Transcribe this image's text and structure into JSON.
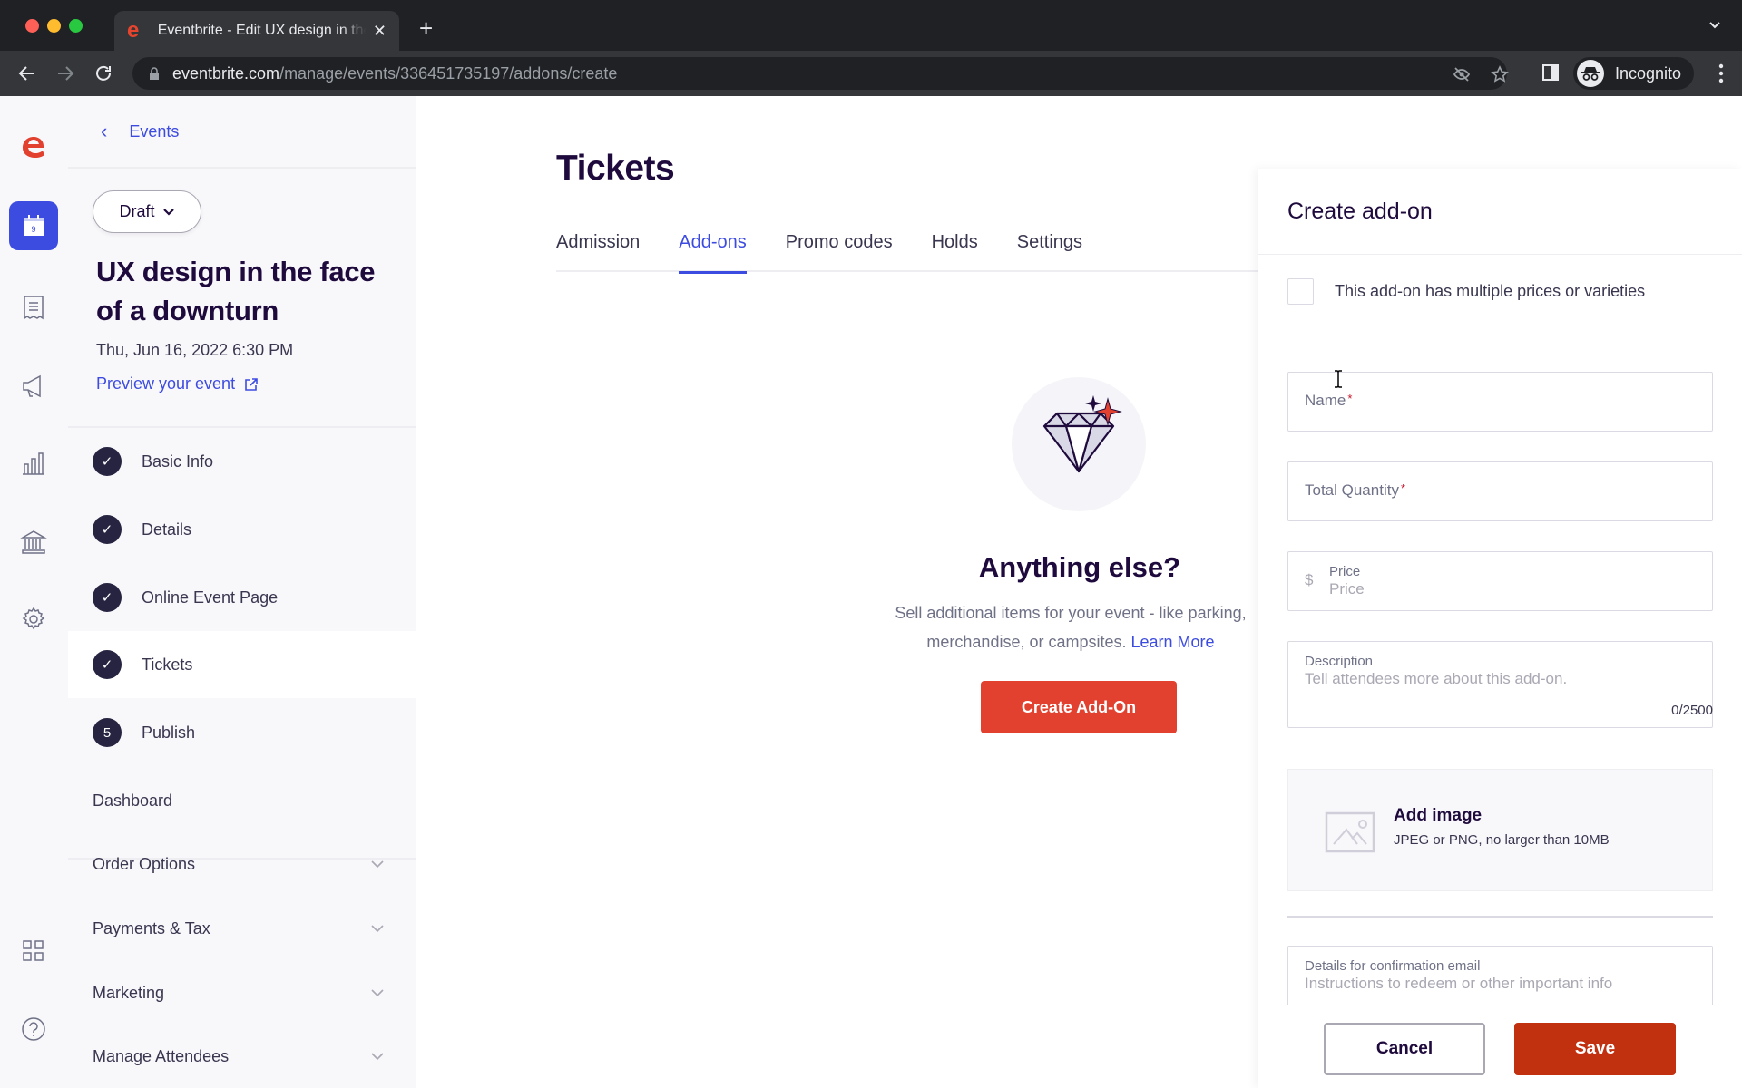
{
  "browser": {
    "tab_title": "Eventbrite - Edit UX design in the face of a downturn",
    "tab_favicon": "e",
    "url_host": "eventbrite.com",
    "url_path": "/manage/events/336451735197/addons/create",
    "profile_label": "Incognito"
  },
  "sidebar": {
    "back_label": "Events",
    "status_label": "Draft",
    "event_title": "UX design in the face of a downturn",
    "event_date": "Thu, Jun 16, 2022 6:30 PM",
    "preview_label": "Preview your event",
    "calendar_day": "9",
    "steps": [
      {
        "label": "Basic Info",
        "badge": "✓",
        "state": "complete"
      },
      {
        "label": "Details",
        "badge": "✓",
        "state": "complete"
      },
      {
        "label": "Online Event Page",
        "badge": "✓",
        "state": "complete"
      },
      {
        "label": "Tickets",
        "badge": "✓",
        "state": "complete-active"
      },
      {
        "label": "Publish",
        "badge": "5",
        "state": "pending"
      }
    ],
    "nav": [
      {
        "label": "Dashboard",
        "expandable": false
      },
      {
        "label": "Order Options",
        "expandable": true
      },
      {
        "label": "Payments & Tax",
        "expandable": true
      },
      {
        "label": "Marketing",
        "expandable": true
      },
      {
        "label": "Manage Attendees",
        "expandable": true
      }
    ]
  },
  "main": {
    "title": "Tickets",
    "tabs": [
      {
        "label": "Admission",
        "active": false
      },
      {
        "label": "Add-ons",
        "active": true
      },
      {
        "label": "Promo codes",
        "active": false
      },
      {
        "label": "Holds",
        "active": false
      },
      {
        "label": "Settings",
        "active": false
      }
    ],
    "empty_state": {
      "title": "Anything else?",
      "desc_line1": "Sell additional items for your event - like parking,",
      "desc_line2": "merchandise, or campsites.",
      "link_label": "Learn More",
      "button_label": "Create Add-On"
    }
  },
  "panel": {
    "title": "Create add-on",
    "multi_price_label": "This add-on has multiple prices or varieties",
    "multi_price_checked": false,
    "name_label": "Name",
    "name_value": "",
    "quantity_label": "Total Quantity",
    "quantity_value": "",
    "price_currency": "$",
    "price_label": "Price",
    "price_placeholder": "Price",
    "description_label": "Description",
    "description_placeholder": "Tell attendees more about this add-on.",
    "description_counter": "0/2500",
    "image_title": "Add image",
    "image_hint": "JPEG or PNG, no larger than 10MB",
    "email_label": "Details for confirmation email",
    "email_placeholder": "Instructions to redeem or other important info",
    "cancel_label": "Cancel",
    "save_label": "Save",
    "required_mark": "*"
  },
  "colors": {
    "brand": "#e2412f",
    "accent": "#3d4ce0",
    "save": "#c1300f",
    "ink": "#1e0a3c"
  }
}
